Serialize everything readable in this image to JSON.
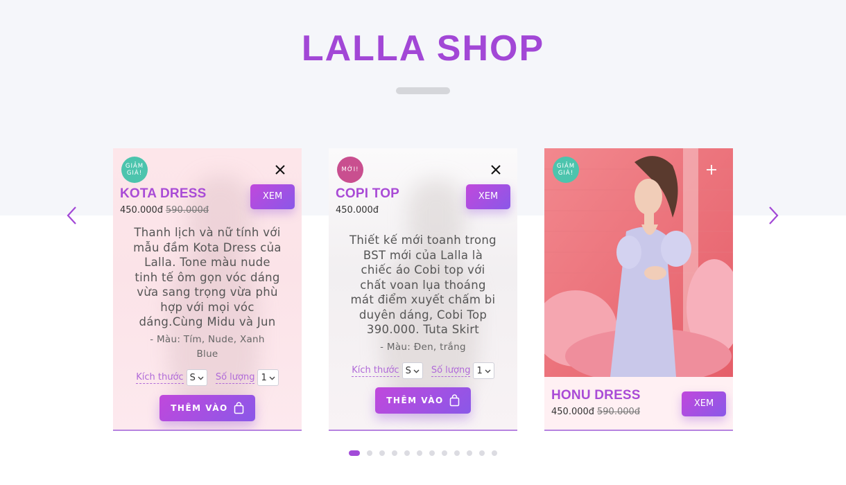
{
  "shop": {
    "title": "LALLA SHOP"
  },
  "colors": {
    "accent": "#a247d6",
    "badge_sale": "#4cc4ad",
    "badge_new": "#c94f8f"
  },
  "cards": [
    {
      "badge": "GIẢM GIÁ!",
      "corner_icon": "close-icon",
      "name": "KOTA DRESS",
      "price": "450.000đ",
      "old_price": "590.000đ",
      "view_label": "XEM",
      "description": "Thanh lịch và nữ tính với mẫu đầm Kota Dress của Lalla. Tone màu nude tinh tế ôm gọn vóc dáng vừa sang trọng vừa phù hợp với mọi vóc dáng.Cùng Midu và Jun",
      "colors_text": "- Màu: Tím, Nude, Xanh Blue",
      "size_label": "Kích thước",
      "size_value": "S",
      "qty_label": "Số lượng",
      "qty_value": "1",
      "add_label": "THÊM VÀO"
    },
    {
      "badge": "MỚI!",
      "corner_icon": "close-icon",
      "name": "COPI TOP",
      "price": "450.000đ",
      "view_label": "XEM",
      "description": "Thiết kế mới toanh trong BST mới của Lalla là chiếc áo Cobi top với chất voan lụa thoáng mát điểm xuyết chấm bi duyên dáng, Cobi Top 390.000. Tuta Skirt",
      "colors_text": "- Màu: Đen, trắng",
      "size_label": "Kích thước",
      "size_value": "S",
      "qty_label": "Số lượng",
      "qty_value": "1",
      "add_label": "THÊM VÀO"
    },
    {
      "badge": "GIẢM GIÁ!",
      "corner_icon": "plus-icon",
      "name": "HONU DRESS",
      "price": "450.000đ",
      "old_price": "590.000đ",
      "view_label": "XEM"
    }
  ],
  "carousel": {
    "slide_count": 12,
    "active_index": 0
  }
}
